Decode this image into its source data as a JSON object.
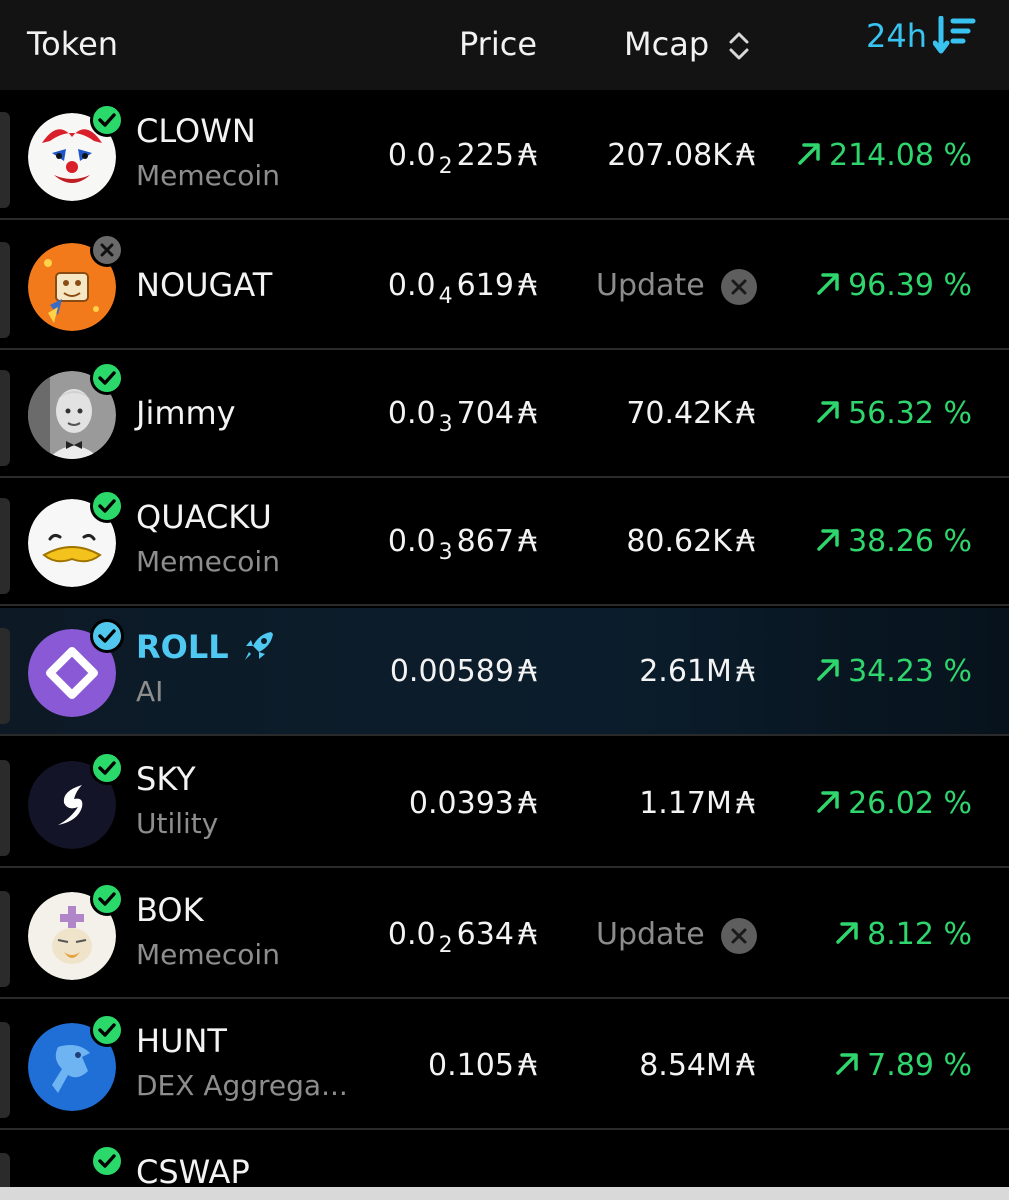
{
  "header": {
    "token_label": "Token",
    "price_label": "Price",
    "mcap_label": "Mcap",
    "period_label": "24h",
    "accent_color": "#39c3f0",
    "sort_icon": "sort-updown-icon",
    "period_sort_icon": "sort-descending-icon"
  },
  "currency_symbol": "₳",
  "colors": {
    "up": "#2fd66d",
    "verified": "#2bd96b",
    "muted": "#8d8d8d"
  },
  "tokens": [
    {
      "name": "CLOWN",
      "category": "Memecoin",
      "verified": true,
      "price_prefix": "0.0",
      "price_zeros": "2",
      "price_digits": "225",
      "mcap": "207.08K",
      "change": "214.08 %"
    },
    {
      "name": "NOUGAT",
      "category": "",
      "verified": false,
      "price_prefix": "0.0",
      "price_zeros": "4",
      "price_digits": "619",
      "mcap_status": "Update",
      "change": "96.39 %"
    },
    {
      "name": "Jimmy",
      "category": "",
      "verified": true,
      "price_prefix": "0.0",
      "price_zeros": "3",
      "price_digits": "704",
      "mcap": "70.42K",
      "change": "56.32 %"
    },
    {
      "name": "QUACKU",
      "category": "Memecoin",
      "verified": true,
      "price_prefix": "0.0",
      "price_zeros": "3",
      "price_digits": "867",
      "mcap": "80.62K",
      "change": "38.26 %"
    },
    {
      "name": "ROLL",
      "category": "AI",
      "verified": true,
      "price": "0.00589",
      "mcap": "2.61M",
      "change": "34.23 %",
      "highlight": true,
      "icon": "rocket-icon"
    },
    {
      "name": "SKY",
      "category": "Utility",
      "verified": true,
      "price": "0.0393",
      "mcap": "1.17M",
      "change": "26.02 %"
    },
    {
      "name": "BOK",
      "category": "Memecoin",
      "verified": true,
      "price_prefix": "0.0",
      "price_zeros": "2",
      "price_digits": "634",
      "mcap_status": "Update",
      "change": "8.12 %"
    },
    {
      "name": "HUNT",
      "category": "DEX Aggrega...",
      "verified": true,
      "price": "0.105",
      "mcap": "8.54M",
      "change": "7.89 %"
    },
    {
      "name": "CSWAP",
      "category": "",
      "verified": true
    }
  ]
}
